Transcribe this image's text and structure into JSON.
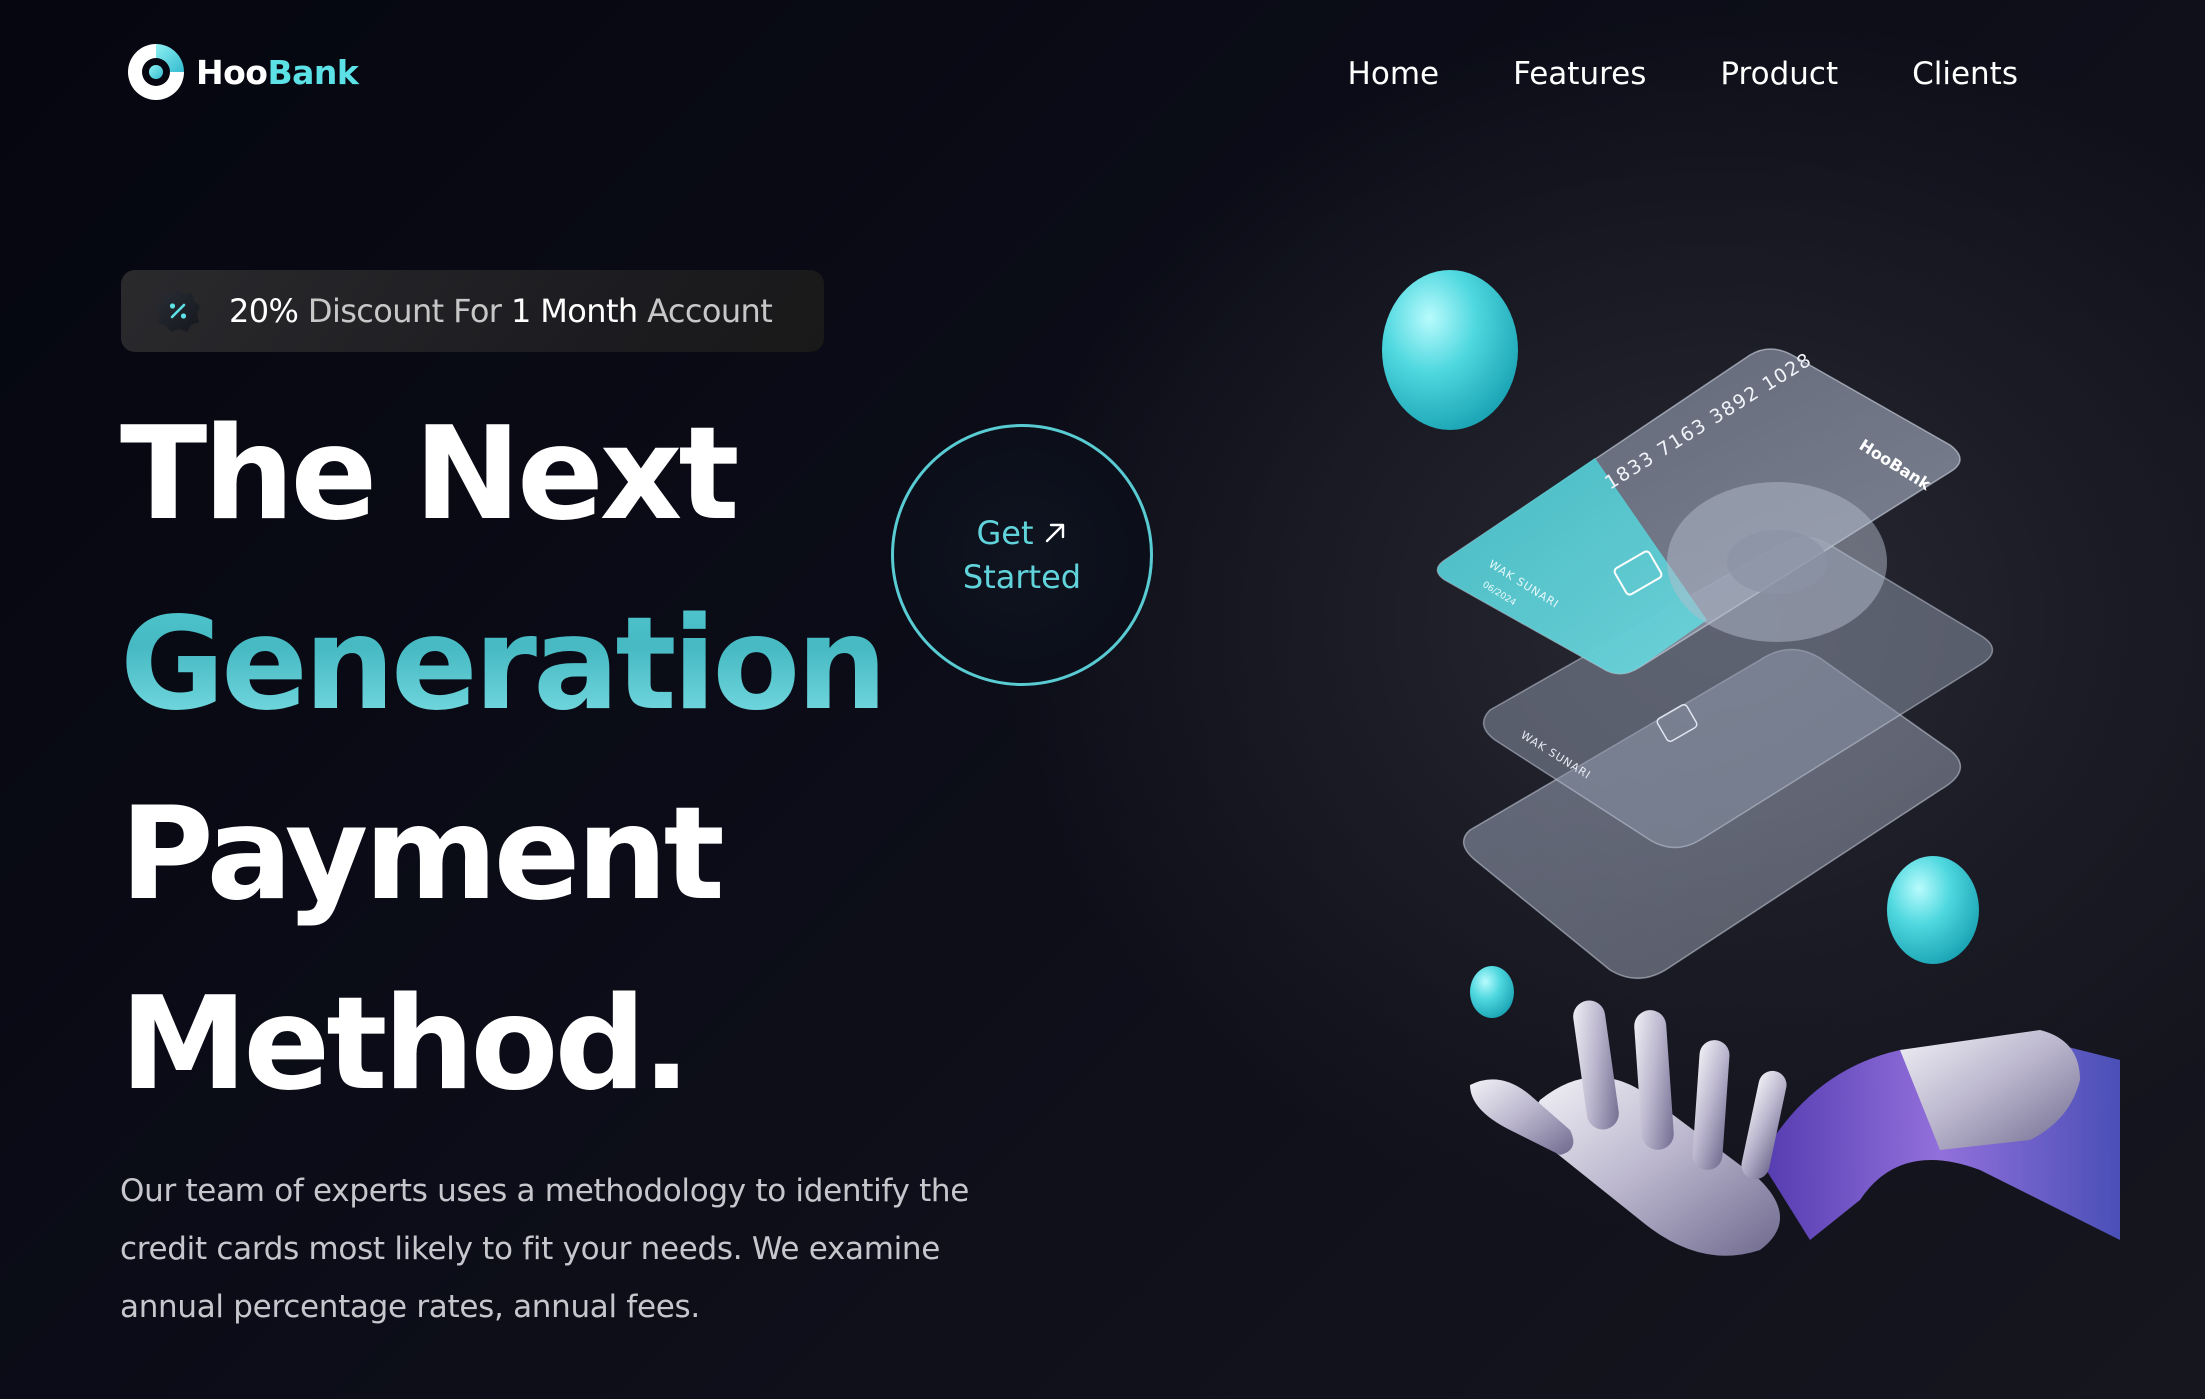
{
  "brand": {
    "name_part1": "Hoo",
    "name_part2": "Bank",
    "accent_color": "#5ce1e6",
    "logo_icon": "hoobank-logo-icon"
  },
  "nav": {
    "items": [
      {
        "label": "Home"
      },
      {
        "label": "Features"
      },
      {
        "label": "Product"
      },
      {
        "label": "Clients"
      }
    ]
  },
  "hero": {
    "promo": {
      "icon": "discount-icon",
      "percent": "20%",
      "text1": "Discount For",
      "highlight": "1 Month",
      "text2": "Account"
    },
    "title": {
      "line1": "The Next",
      "line2": "Generation",
      "line3": "Payment",
      "line4": "Method."
    },
    "cta": {
      "line1": "Get",
      "line2": "Started",
      "icon": "arrow-up-right-icon"
    },
    "description": "Our team of experts uses a methodology to identify the credit cards most likely to fit your needs. We examine annual percentage rates, annual fees."
  },
  "illustration": {
    "card_number": "1833 7163 3892 1028",
    "card_brand": "HooBank",
    "card_holder": "WAK SUNARI",
    "card_expiry": "06/2024",
    "colors": {
      "teal": "#5ce1e6",
      "glass": "#c9d4e8"
    }
  }
}
